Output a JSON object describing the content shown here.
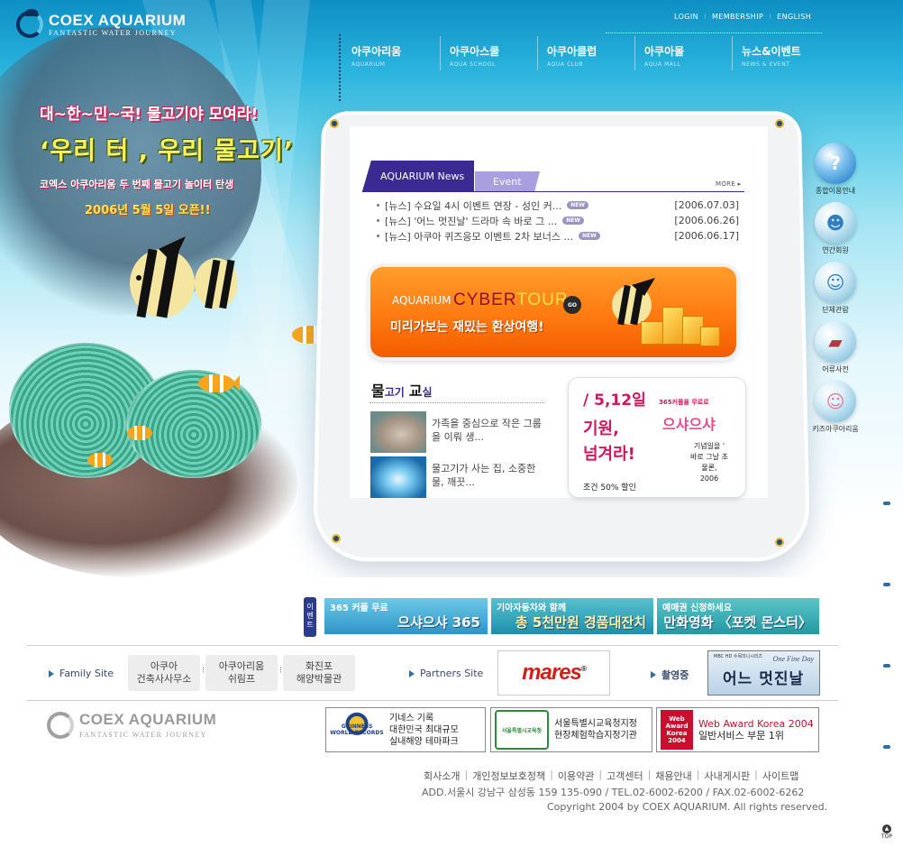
{
  "header": {
    "logo_title": "COEX AQUARIUM",
    "logo_sub": "FANTASTIC WATER JOURNEY",
    "util_links": [
      "LOGIN",
      "MEMBERSHIP",
      "ENGLISH"
    ]
  },
  "gnb": [
    {
      "label": "아쿠아리움",
      "sub": "AQUARIUM"
    },
    {
      "label": "아쿠아스쿨",
      "sub": "AQUA SCHOOL"
    },
    {
      "label": "아쿠아클럽",
      "sub": "AQUA CLUB"
    },
    {
      "label": "아쿠아몰",
      "sub": "AQUA MALL"
    },
    {
      "label": "뉴스&이벤트",
      "sub": "NEWS & EVENT"
    }
  ],
  "promo": {
    "line1": "대~한~민~국! 물고기야 모여라!",
    "line2": "‘우리 터 , 우리 물고기’",
    "line3": "코엑스 아쿠아리움 두 번째 물고기 놀이터 탄생",
    "line4": "2006년 5월 5일 오픈!!"
  },
  "news": {
    "tab_news": "AQUARIUM News",
    "tab_event": "Event",
    "more": "MORE",
    "items": [
      {
        "title": "[뉴스] 수요일 4시 이벤트 연장 - 성인 커...",
        "badge": "NEW",
        "date": "[2006.07.03]"
      },
      {
        "title": "[뉴스] '어느 멋진날' 드라마 속 바로 그 ...",
        "badge": "NEW",
        "date": "[2006.06.26]"
      },
      {
        "title": "[뉴스] 아쿠아 퀴즈응모 이벤트 2차 보너스 ...",
        "badge": "NEW",
        "date": "[2006.06.17]"
      }
    ]
  },
  "cyber": {
    "small": "AQUARIUM",
    "cyber": "CYBER",
    "tour": "TOUR",
    "go": "GO",
    "sub": "미리가보는 재밌는 환상여행!"
  },
  "edu": {
    "title_a": "물",
    "title_b": "고기",
    "title_c": "교",
    "title_d": "실",
    "items": [
      {
        "text": "가족을 중심으로 작은 그룹을 이뤄 생..."
      },
      {
        "text": "물고기가 사는 집, 소중한 물, 깨끗..."
      }
    ]
  },
  "event_card": {
    "date": "/ 5,12일",
    "small": "365커플을 무료로",
    "shasha": "으샤으샤",
    "line1": "기원,",
    "line2": "넘겨라!",
    "right": "기념일을 '\n바로 그날 초\n물론,\n2006",
    "bottom": "조건 50% 할인"
  },
  "side_menu": [
    {
      "label": "종합이용안내",
      "icon": "question-icon"
    },
    {
      "label": "연간회원",
      "icon": "member-icon"
    },
    {
      "label": "단체관람",
      "icon": "group-icon"
    },
    {
      "label": "어류사전",
      "icon": "book-icon"
    },
    {
      "label": "키즈아쿠아리움",
      "icon": "kid-icon"
    }
  ],
  "event_strip": {
    "tab": "이벤트",
    "banners": [
      {
        "top": "365 커플 무료",
        "main": "으샤으샤 365"
      },
      {
        "top": "기아자동차와 함께",
        "main": "총 5천만원 경품대잔치"
      },
      {
        "top": "예매권 신청하세요",
        "main": "만화영화 〈포켓 몬스터〉"
      }
    ]
  },
  "family": {
    "label": "Family Site",
    "sites": [
      "아쿠아\n건축사사무소",
      "아쿠아리움\n쉬림프",
      "화진포\n해양박물관"
    ]
  },
  "partners": {
    "label": "Partners Site",
    "brand_a": "mares",
    "brand_b": "",
    "mark": "®"
  },
  "shooting": {
    "label": "촬영중",
    "small": "MBC HD 수목미니시리즈",
    "en": "One Fine Day",
    "title": "어느 멋진날"
  },
  "footer_logo": {
    "title": "COEX AQUARIUM",
    "sub": "FANTASTIC WATER JOURNEY"
  },
  "certs": [
    {
      "logo": "GUINNESS\nWORLD RECORDS",
      "text": "기네스 기록\n대한민국 최대규모\n실내해양 테마파크"
    },
    {
      "logo": "서울특별시교육청",
      "text": "서울특별시교육청지정\n현장체험학습지정기관"
    },
    {
      "logo": "Web\nAward\nKorea\n2004",
      "text_a": "Web Award Korea 2004",
      "text_b": "일반서비스 부문 1위"
    }
  ],
  "footer": {
    "links": [
      "회사소개",
      "개인정보보호정책",
      "이용약관",
      "고객센터",
      "채용안내",
      "사내게시판",
      "사이트맵"
    ],
    "address": "ADD.서울시 강남구 삼성동 159 135-090 / TEL.02-6002-6200 / FAX.02-6002-6262",
    "copyright": "Copyright 2004 by COEX AQUARIUM. All rights reserved."
  },
  "top_button": {
    "label": "TOP"
  }
}
